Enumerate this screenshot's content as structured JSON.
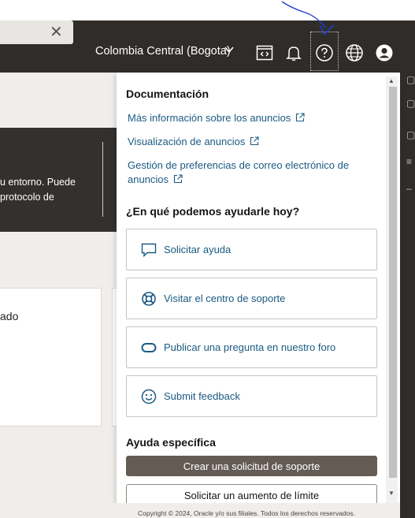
{
  "header": {
    "search_clear": "✕",
    "region": "Colombia Central (Bogota)",
    "icons": [
      "code-editor-icon",
      "bell-icon",
      "help-icon",
      "globe-icon",
      "user-avatar-icon"
    ]
  },
  "background": {
    "banner_text_line1": "u entorno. Puede",
    "banner_text_line2": "protocolo de",
    "card_text": "ado"
  },
  "panel": {
    "doc_title": "Documentación",
    "doc_links": [
      "Más información sobre los anuncios",
      "Visualización de anuncios",
      "Gestión de preferencias de correo electrónico de anuncios"
    ],
    "help_title": "¿En qué podemos ayudarle hoy?",
    "help_cards": [
      {
        "label": "Solicitar ayuda",
        "icon": "chat-icon"
      },
      {
        "label": "Visitar el centro de soporte",
        "icon": "lifebuoy-icon"
      },
      {
        "label": "Publicar una pregunta en nuestro foro",
        "icon": "oracle-forum-icon"
      },
      {
        "label": "Submit feedback",
        "icon": "smiley-icon"
      }
    ],
    "specific_title": "Ayuda específica",
    "primary_button": "Crear una solicitud de soporte",
    "secondary_button": "Solicitar un aumento de límite"
  },
  "footer": {
    "copyright": "Copyright © 2024, Oracle y/o sus filiales. Todos los derechos reservados."
  },
  "colors": {
    "header_bg": "#2f2c2a",
    "link": "#1a5a83",
    "primary_button": "#655b55",
    "annotation": "#1f3fd6"
  }
}
